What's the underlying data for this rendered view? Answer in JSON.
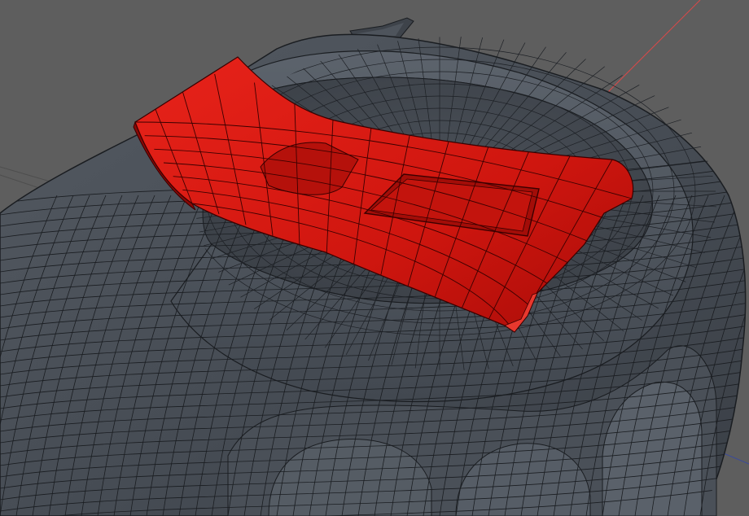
{
  "viewport": {
    "background_color": "#5e5e5e",
    "mesh_color": "#4a5058",
    "mesh_wire_color": "#1a1d21",
    "selection_color": "#d81a10",
    "selection_wire_color": "#3a0000",
    "axis_x_color": "#d94848",
    "axis_y_color": "#3a4a9a",
    "grid_line_color": "#3f3f3f"
  },
  "scene": {
    "object": "mesh-body",
    "selected_part": "red-panel-selection",
    "shading": "flat-wireframe-overlay"
  }
}
